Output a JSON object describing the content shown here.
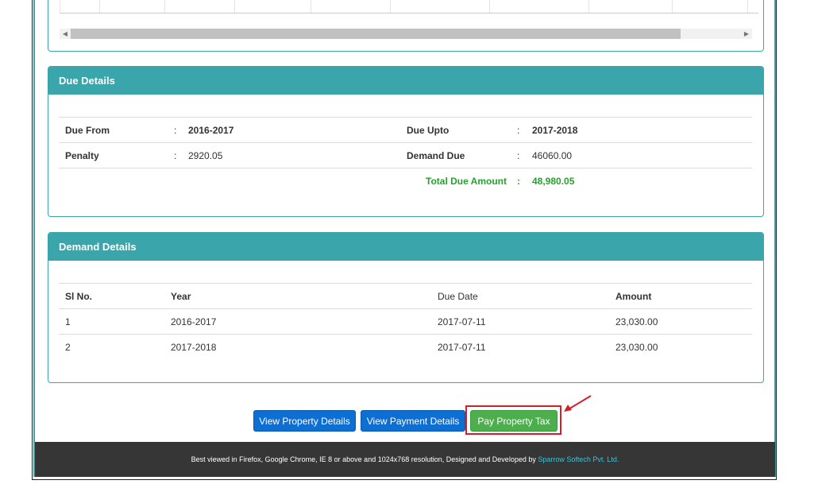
{
  "due_details": {
    "title": "Due Details",
    "due_from_label": "Due From",
    "due_from_value": "2016-2017",
    "due_upto_label": "Due Upto",
    "due_upto_value": "2017-2018",
    "penalty_label": "Penalty",
    "penalty_value": "2920.05",
    "demand_due_label": "Demand Due",
    "demand_due_value": "46060.00",
    "total_label": "Total Due Amount",
    "total_value": "48,980.05",
    "sep": ":"
  },
  "demand_details": {
    "title": "Demand Details",
    "headers": [
      "Sl No.",
      "Year",
      "Due Date",
      "Amount"
    ],
    "rows": [
      {
        "sl": "1",
        "year": "2016-2017",
        "due_date": "2017-07-11",
        "amount": "23,030.00"
      },
      {
        "sl": "2",
        "year": "2017-2018",
        "due_date": "2017-07-11",
        "amount": "23,030.00"
      }
    ]
  },
  "actions": {
    "view_property": "View Property Details",
    "view_payment": "View Payment Details",
    "pay_tax": "Pay Property Tax"
  },
  "footer": {
    "text": "Best viewed in Firefox, Google Chrome, IE 8 or above and 1024x768 resolution, Designed and Developed by ",
    "company": "Sparrow Softech Pvt. Ltd."
  },
  "colors": {
    "panel_header": "#3aa5ab",
    "button_blue": "#0d6fd3",
    "button_green": "#4cae4c",
    "highlight_red": "#d0202a"
  }
}
